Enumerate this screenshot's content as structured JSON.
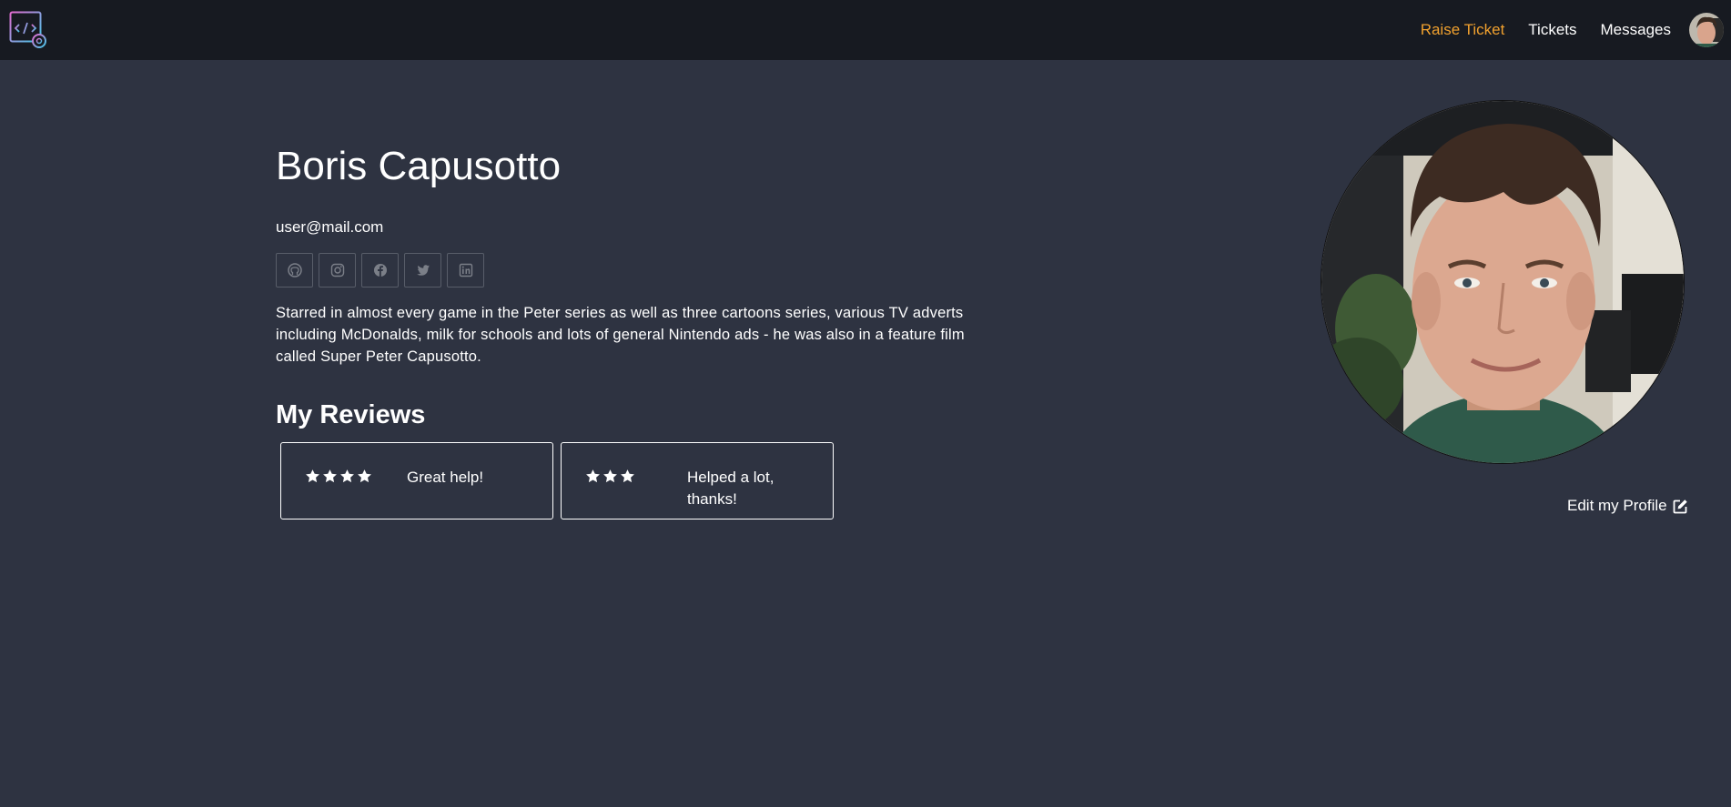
{
  "nav": {
    "links": [
      "Raise Ticket",
      "Tickets",
      "Messages"
    ],
    "active_color": "#f0a02e"
  },
  "profile": {
    "name": "Boris Capusotto",
    "email": "user@mail.com",
    "socials": [
      "github-icon",
      "instagram-icon",
      "facebook-icon",
      "twitter-icon",
      "linkedin-icon"
    ],
    "bio": "Starred in almost every game in the Peter series as well as three cartoons series, various TV adverts including McDonalds, milk for schools and lots of general Nintendo ads - he was also in a feature film called Super Peter Capusotto.",
    "edit_label": "Edit my Profile"
  },
  "reviews": {
    "title": "My Reviews",
    "items": [
      {
        "rating": 4,
        "text": "Great help!"
      },
      {
        "rating": 3,
        "text": "Helped a lot, thanks!"
      }
    ]
  },
  "colors": {
    "background": "#2e3341",
    "navbar": "#171a21"
  }
}
